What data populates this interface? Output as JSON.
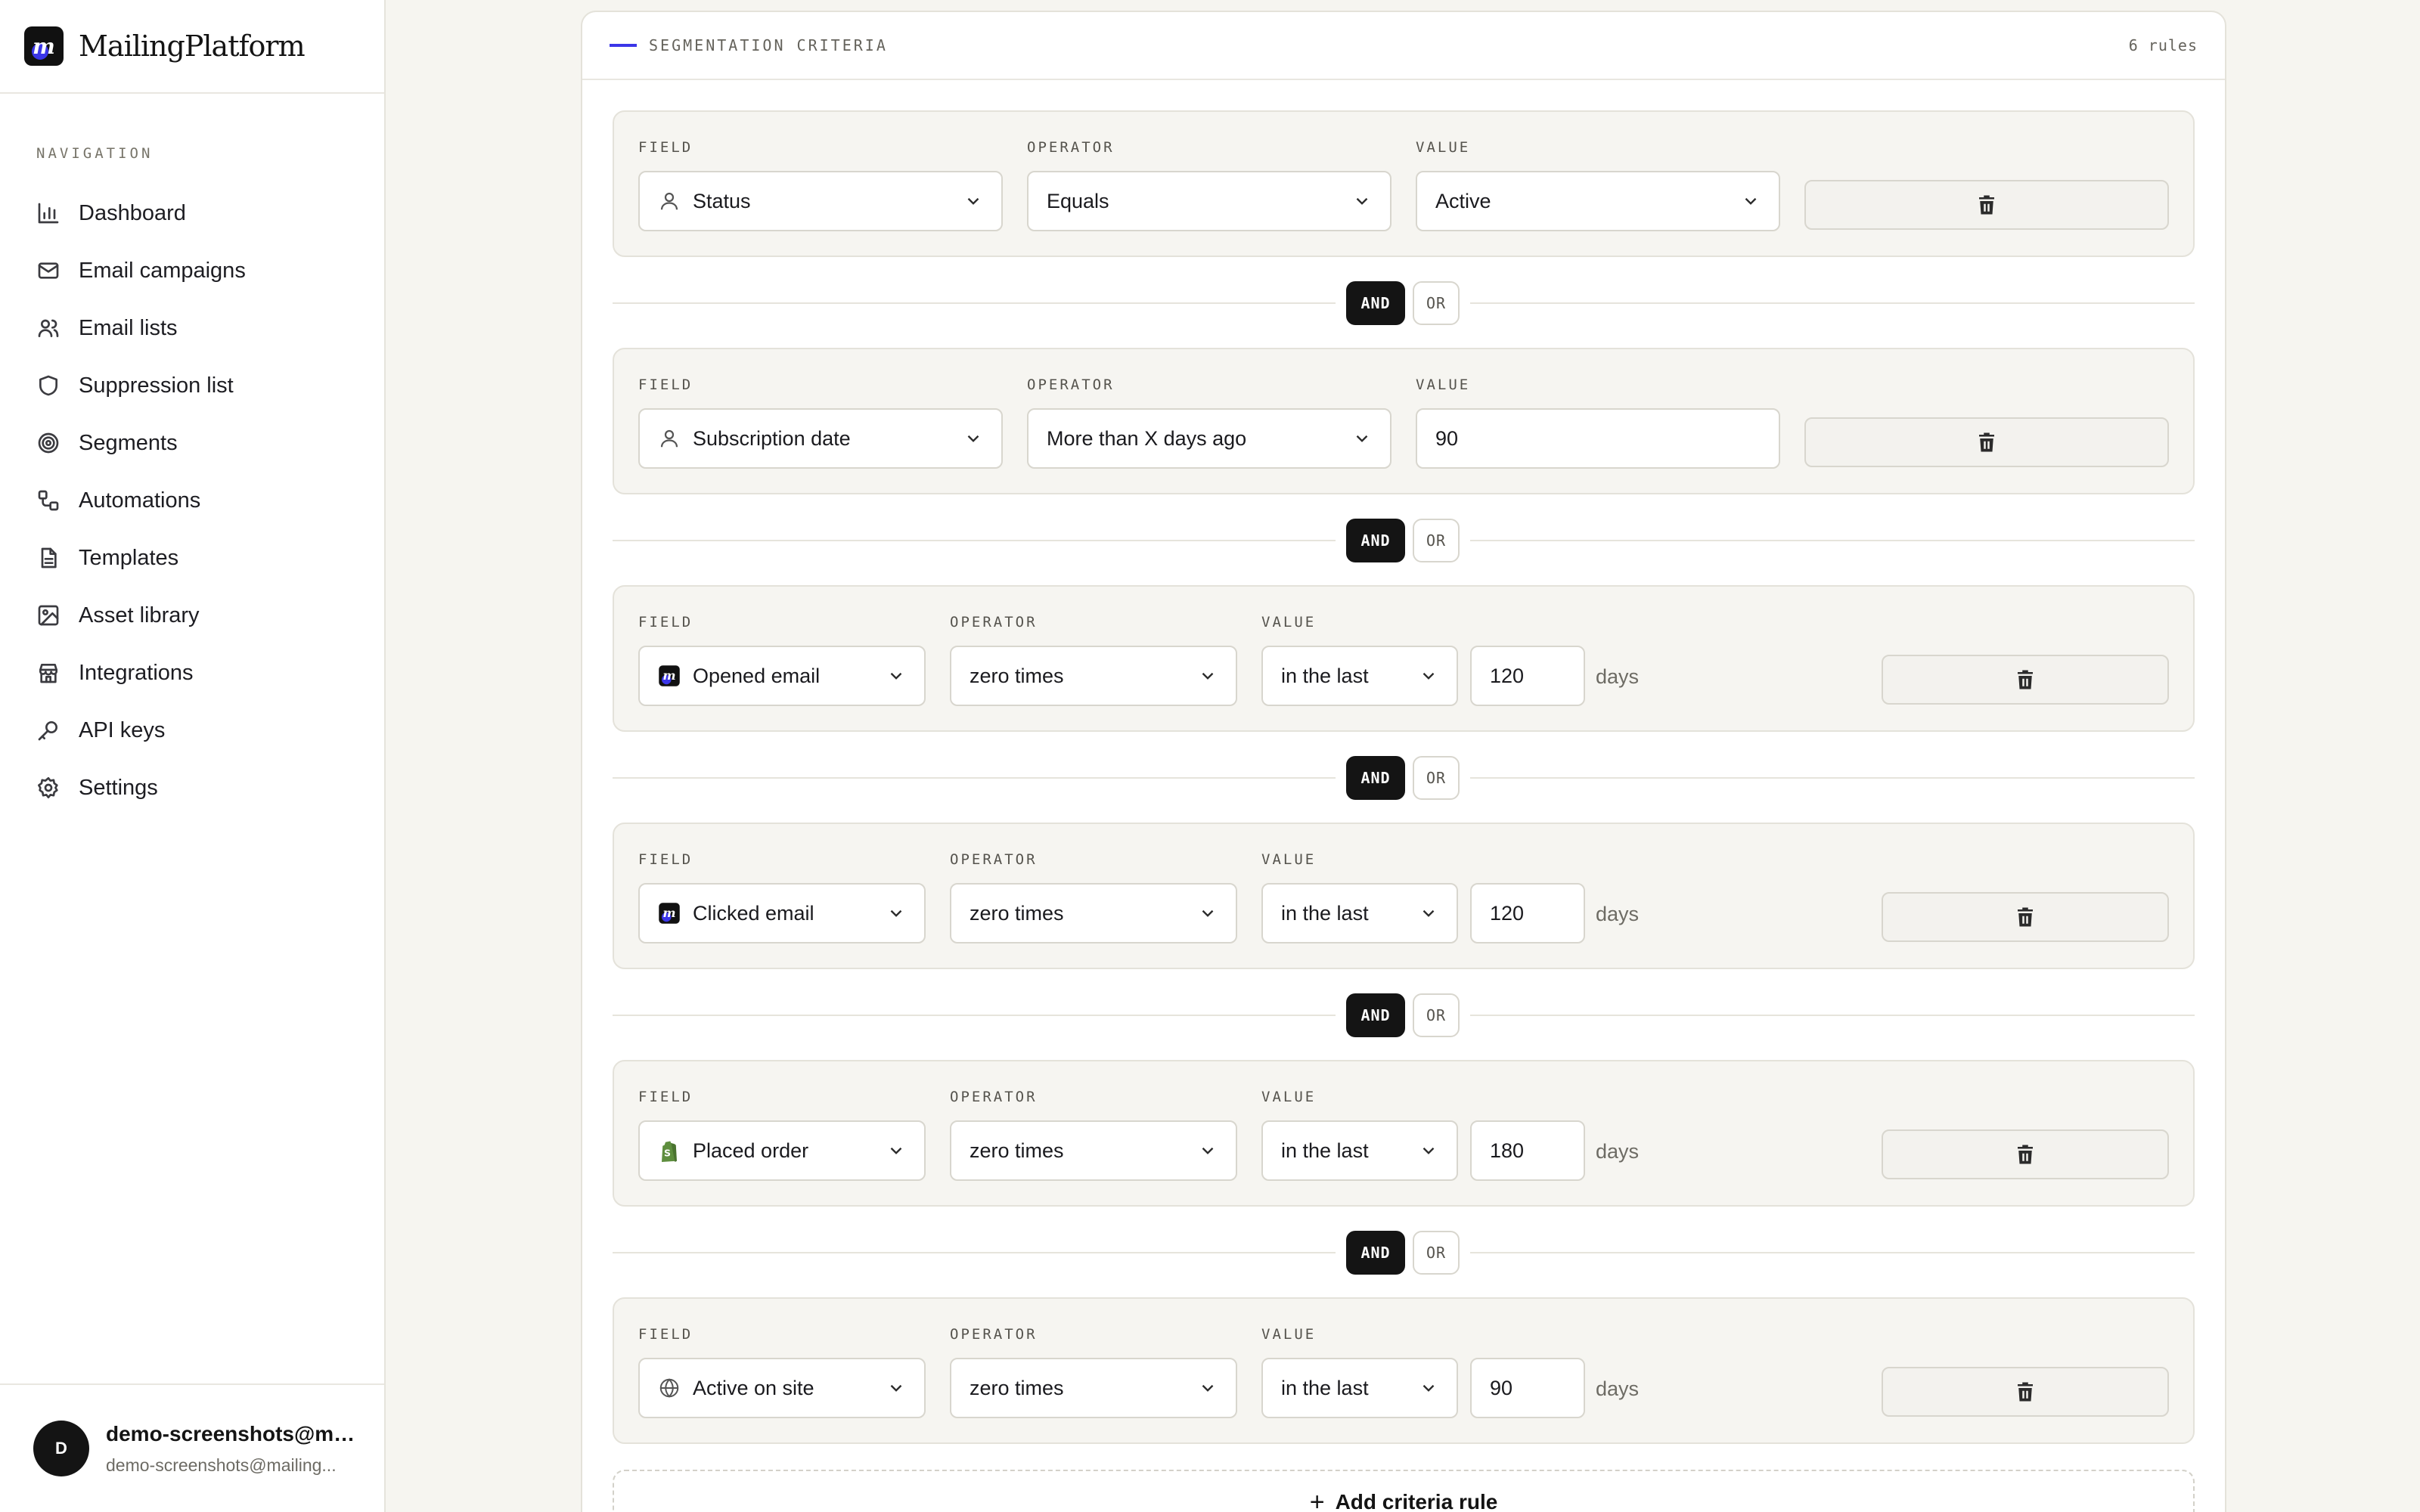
{
  "brand": {
    "name": "MailingPlatform",
    "logo_letter": "m"
  },
  "navigation": {
    "heading": "NAVIGATION",
    "items": [
      {
        "label": "Dashboard",
        "icon": "bar-chart-icon"
      },
      {
        "label": "Email campaigns",
        "icon": "mail-icon"
      },
      {
        "label": "Email lists",
        "icon": "users-icon"
      },
      {
        "label": "Suppression list",
        "icon": "shield-icon"
      },
      {
        "label": "Segments",
        "icon": "target-icon"
      },
      {
        "label": "Automations",
        "icon": "workflow-icon"
      },
      {
        "label": "Templates",
        "icon": "document-icon"
      },
      {
        "label": "Asset library",
        "icon": "image-icon"
      },
      {
        "label": "Integrations",
        "icon": "store-icon"
      },
      {
        "label": "API keys",
        "icon": "key-icon"
      },
      {
        "label": "Settings",
        "icon": "gear-icon"
      }
    ]
  },
  "user": {
    "initial": "D",
    "name": "demo-screenshots@ma...",
    "email": "demo-screenshots@mailing..."
  },
  "criteria": {
    "title": "SEGMENTATION CRITERIA",
    "count_label": "6 rules",
    "labels": {
      "field": "FIELD",
      "operator": "OPERATOR",
      "value": "VALUE",
      "days": "days"
    },
    "connector": {
      "and": "AND",
      "or": "OR",
      "selected": "AND"
    },
    "add_rule_label": "Add criteria rule",
    "rules": [
      {
        "field": "Status",
        "field_icon": "user-icon",
        "operator": "Equals",
        "value": "Active"
      },
      {
        "field": "Subscription date",
        "field_icon": "user-icon",
        "operator": "More than X days ago",
        "value": "90"
      },
      {
        "field": "Opened email",
        "field_icon": "mailingplatform-logo-icon",
        "operator": "zero times",
        "timeframe": "in the last",
        "value": "120"
      },
      {
        "field": "Clicked email",
        "field_icon": "mailingplatform-logo-icon",
        "operator": "zero times",
        "timeframe": "in the last",
        "value": "120"
      },
      {
        "field": "Placed order",
        "field_icon": "shopify-bag-icon",
        "operator": "zero times",
        "timeframe": "in the last",
        "value": "180"
      },
      {
        "field": "Active on site",
        "field_icon": "globe-icon",
        "operator": "zero times",
        "timeframe": "in the last",
        "value": "90"
      }
    ]
  },
  "colors": {
    "accent": "#3b36e8",
    "page_background": "#f6f5f0",
    "and_selected": "#141414",
    "shopify_green": "#5e8e3e"
  }
}
